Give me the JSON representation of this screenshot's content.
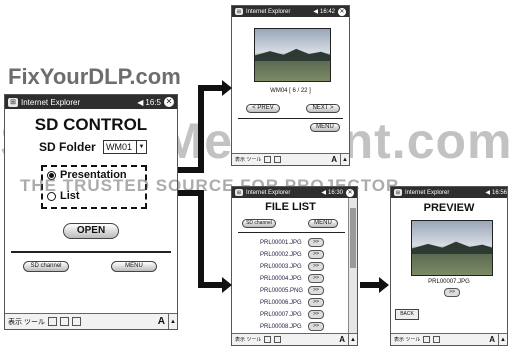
{
  "watermarks": {
    "top": "FixYourDLP.com",
    "middle": "Scout-Merchant.com",
    "band": "THE TRUSTED SOURCE FOR PROJECTOR"
  },
  "main": {
    "title_bar": {
      "app": "Internet Explorer",
      "time": "16:5",
      "windows_icon": "windows-flag-icon",
      "speaker_icon": "speaker-icon",
      "close_icon": "close-icon"
    },
    "heading": "SD CONTROL",
    "folder_label": "SD Folder",
    "folder_value": "WM01",
    "options": [
      {
        "label": "Presentation",
        "selected": true
      },
      {
        "label": "List",
        "selected": false
      }
    ],
    "open_label": "OPEN",
    "sd_channel_label": "SD channel",
    "menu_label": "MENU",
    "bottom_bar": {
      "text": "表示 ツール",
      "font": "A"
    }
  },
  "presentation": {
    "title_bar": {
      "app": "Internet Explorer",
      "time": "16:42"
    },
    "caption": "WM04 [ 6 / 22 ]",
    "prev_label": "< PREV",
    "next_label": "NEXT >",
    "menu_label": "MENU",
    "bottom_bar": {
      "text": "表示 ツール",
      "font": "A"
    }
  },
  "file_list": {
    "title_bar": {
      "app": "Internet Explorer",
      "time": "16:30"
    },
    "heading": "FILE LIST",
    "sd_channel_label": "SD channel",
    "menu_label": "MENU",
    "files": [
      "PRL00001.JPG",
      "PRL00002.JPG",
      "PRL00003.JPG",
      "PRL00004.JPG",
      "PRL00005.PNG",
      "PRL00006.JPG",
      "PRL00007.JPG",
      "PRL00008.JPG"
    ],
    "go_label": ">>",
    "bottom_bar": {
      "text": "表示 ツール",
      "font": "A"
    }
  },
  "preview": {
    "title_bar": {
      "app": "Internet Explorer",
      "time": "16:56"
    },
    "heading": "PREVIEW",
    "caption": "PRL00007.JPG",
    "go_label": ">>",
    "back_label": "BACK",
    "bottom_bar": {
      "text": "表示 ツール",
      "font": "A"
    }
  }
}
